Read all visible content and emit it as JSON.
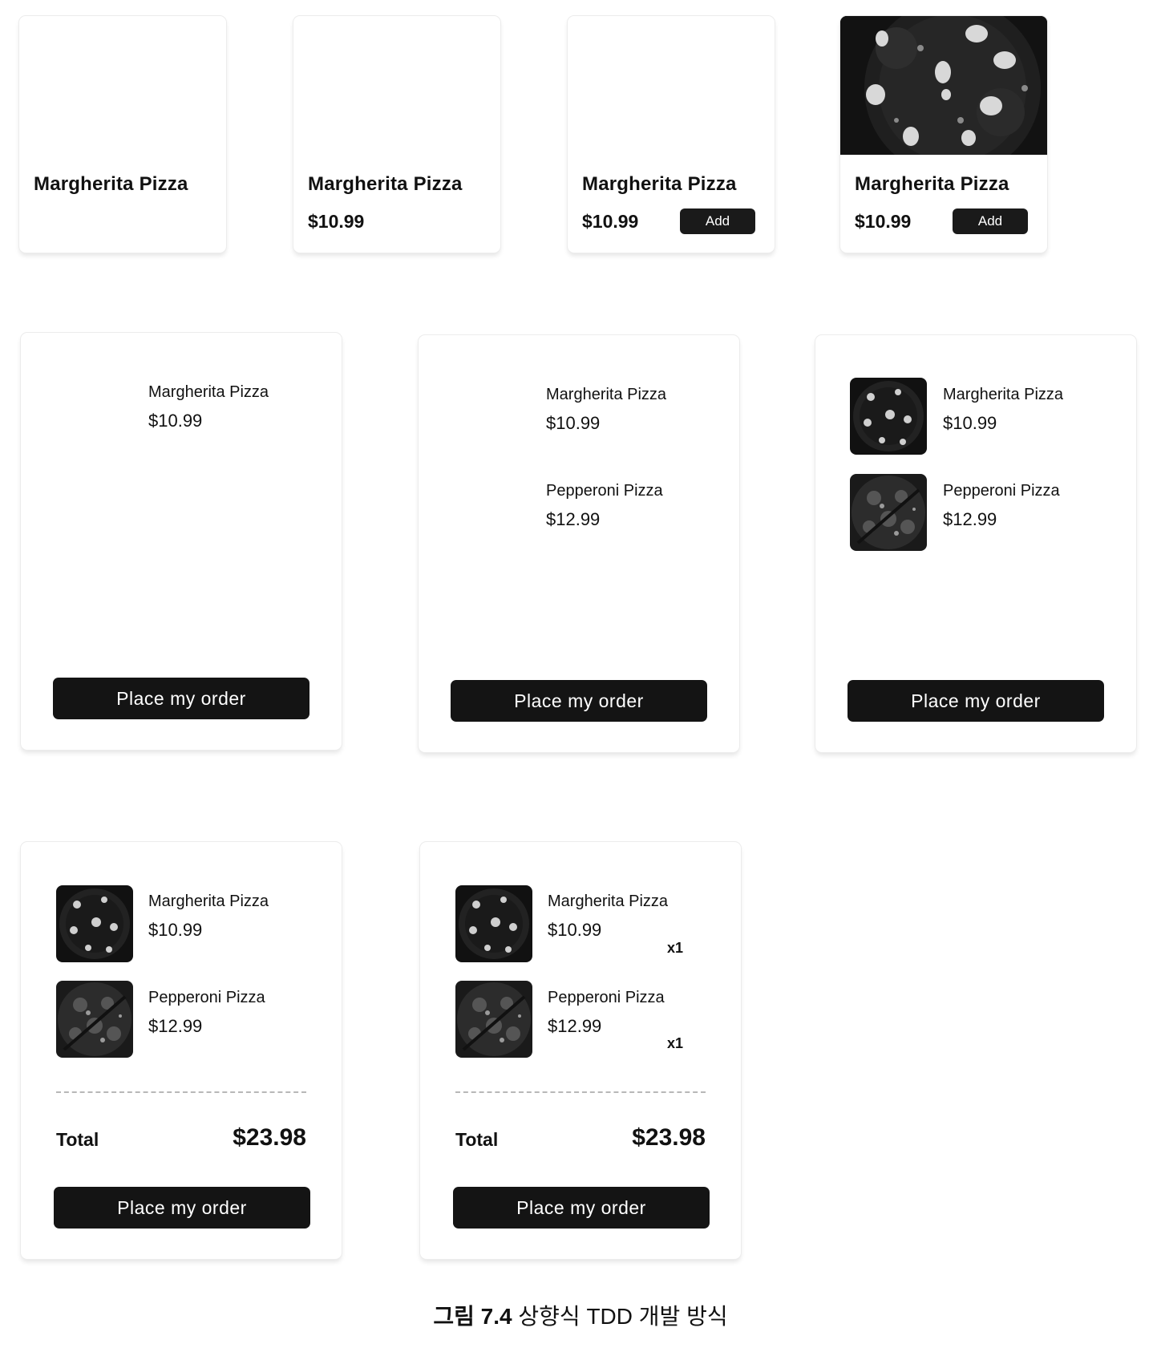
{
  "product": {
    "name": "Margherita Pizza",
    "price": "$10.99",
    "add_label": "Add"
  },
  "cart_items": [
    {
      "name": "Margherita Pizza",
      "price": "$10.99",
      "quantity": "x1",
      "image_icon": "margherita-pizza-image"
    },
    {
      "name": "Pepperoni Pizza",
      "price": "$12.99",
      "quantity": "x1",
      "image_icon": "pepperoni-pizza-image"
    }
  ],
  "order_button_label": "Place my order",
  "total": {
    "label": "Total",
    "value": "$23.98"
  },
  "caption": {
    "figure": "그림 7.4",
    "text": "상향식 TDD 개발 방식"
  }
}
